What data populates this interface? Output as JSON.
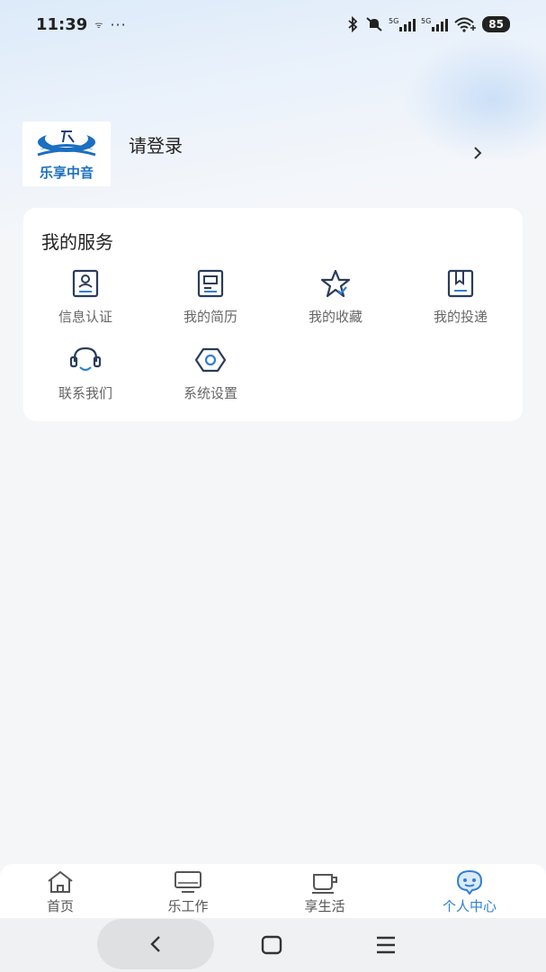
{
  "status_bar": {
    "time": "11:39",
    "signal_small": "ᯤ",
    "dots": "···",
    "battery": "85",
    "network_1": "5G",
    "network_2": "5G"
  },
  "profile": {
    "logo_text": "乐享中音",
    "login_label": "请登录"
  },
  "services": {
    "title": "我的服务",
    "items": [
      {
        "label": "信息认证",
        "icon": "id-card-icon"
      },
      {
        "label": "我的简历",
        "icon": "resume-icon"
      },
      {
        "label": "我的收藏",
        "icon": "star-icon"
      },
      {
        "label": "我的投递",
        "icon": "delivery-icon"
      },
      {
        "label": "联系我们",
        "icon": "headset-icon"
      },
      {
        "label": "系统设置",
        "icon": "settings-icon"
      }
    ]
  },
  "tabs": [
    {
      "label": "首页",
      "icon": "home-icon",
      "active": false
    },
    {
      "label": "乐工作",
      "icon": "monitor-icon",
      "active": false
    },
    {
      "label": "享生活",
      "icon": "cup-icon",
      "active": false
    },
    {
      "label": "个人中心",
      "icon": "chat-face-icon",
      "active": true
    }
  ],
  "colors": {
    "accent": "#2f7fd6",
    "icon_stroke": "#2a3c5a",
    "inactive_tab": "#555555"
  }
}
